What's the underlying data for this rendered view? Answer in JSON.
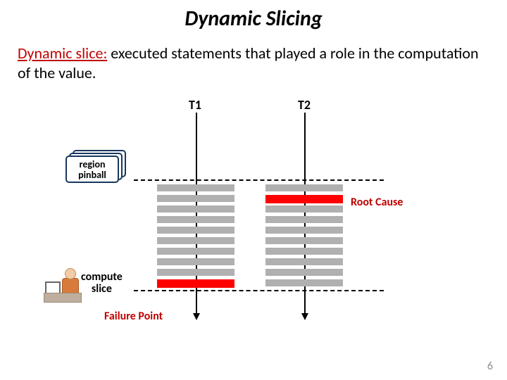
{
  "title": "Dynamic Slicing",
  "definition": {
    "term": "Dynamic slice:",
    "rest": " executed statements that played a role in the computation of the value."
  },
  "threads": {
    "t1": "T1",
    "t2": "T2"
  },
  "labels": {
    "region_pinball_l1": "region",
    "region_pinball_l2": "pinball",
    "compute_slice_l1": "compute",
    "compute_slice_l2": "slice",
    "root_cause": "Root Cause",
    "failure_point": "Failure Point"
  },
  "slide_number": "6"
}
